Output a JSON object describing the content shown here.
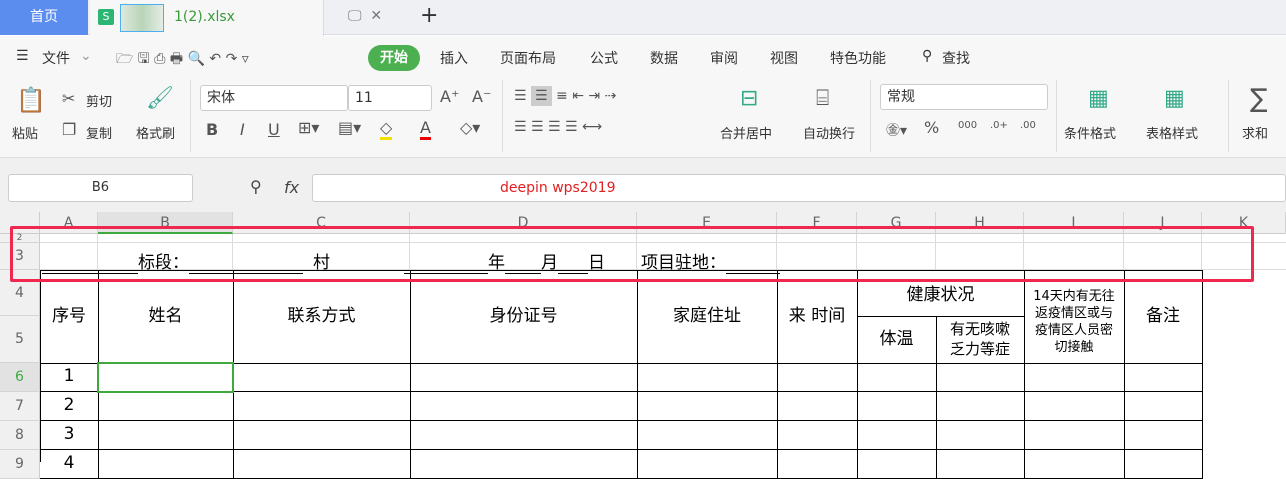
{
  "tabs": {
    "home": "首页",
    "doc": "1(2).xlsx",
    "doc_icon": "S",
    "add": "+"
  },
  "menu": {
    "file": "文件",
    "items": [
      "开始",
      "插入",
      "页面布局",
      "公式",
      "数据",
      "审阅",
      "视图",
      "特色功能"
    ],
    "search": "查找"
  },
  "ribbon": {
    "paste": "粘贴",
    "cut": "剪切",
    "copy": "复制",
    "format_painter": "格式刷",
    "font": "宋体",
    "size": "11",
    "merge": "合并居中",
    "wrap": "自动换行",
    "number_format": "常规",
    "cond_format": "条件格式",
    "table_style": "表格样式",
    "sum": "求和",
    "bold": "B",
    "italic": "I",
    "underline": "U",
    "percent": "%",
    "thousands": "000",
    "inc_dec": ".0+",
    "dec_dec": ".00"
  },
  "formula_bar": {
    "cell_ref": "B6",
    "fx": "fx",
    "watermark": "deepin   wps2019"
  },
  "columns": [
    "A",
    "B",
    "C",
    "D",
    "E",
    "F",
    "G",
    "H",
    "I",
    "J",
    "K"
  ],
  "rows": [
    "2",
    "3",
    "4",
    "5",
    "6",
    "7",
    "8",
    "9"
  ],
  "sheet": {
    "row3": {
      "section": "标段：",
      "village": "村",
      "year": "年",
      "month": "月",
      "day": "日",
      "site": "项目驻地："
    },
    "headers": {
      "no": "序号",
      "name": "姓名",
      "contact": "联系方式",
      "id": "身份证号",
      "address": "家庭住址",
      "arrival": "来  时间",
      "health": "健康状况",
      "temp": "体温",
      "symptoms": "有无咳嗽乏力等症",
      "contact14": "14天内有无往返疫情区或与疫情区人员密切接触",
      "remark": "备注"
    },
    "serials": [
      "1",
      "2",
      "3",
      "4"
    ]
  }
}
